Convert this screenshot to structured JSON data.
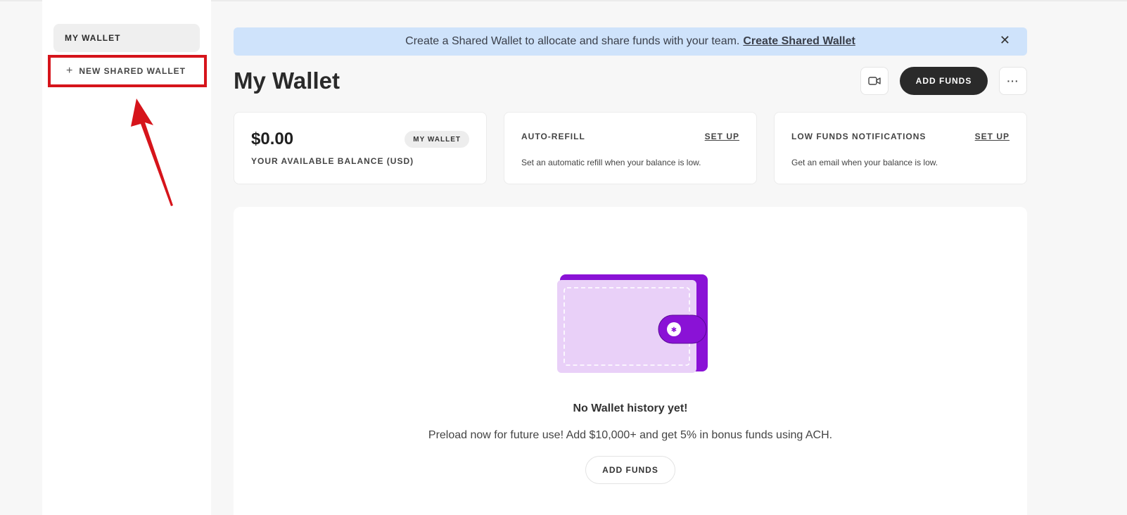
{
  "sidebar": {
    "my_wallet": "MY WALLET",
    "new_shared_wallet": "NEW SHARED WALLET",
    "plus_glyph": "+"
  },
  "banner": {
    "text": "Create a Shared Wallet to allocate and share funds with your team.",
    "link": "Create Shared Wallet",
    "close_glyph": "✕"
  },
  "header": {
    "title": "My Wallet",
    "add_funds": "ADD FUNDS",
    "more_glyph": "···"
  },
  "balance_card": {
    "amount": "$0.00",
    "label": "YOUR AVAILABLE BALANCE (USD)",
    "chip": "MY WALLET"
  },
  "auto_refill": {
    "title": "AUTO-REFILL",
    "link": "SET UP",
    "desc": "Set an automatic refill when your balance is low."
  },
  "low_funds": {
    "title": "LOW FUNDS NOTIFICATIONS",
    "link": "SET UP",
    "desc": "Get an email when your balance is low."
  },
  "empty_state": {
    "title": "No Wallet history yet!",
    "desc": "Preload now for future use! Add $10,000+ and get 5% in bonus funds using ACH.",
    "button": "ADD FUNDS"
  },
  "colors": {
    "highlight_red": "#d6141b",
    "banner_blue": "#cfe3fb",
    "wallet_purple": "#8a12d6",
    "wallet_light": "#e9d0f8"
  }
}
